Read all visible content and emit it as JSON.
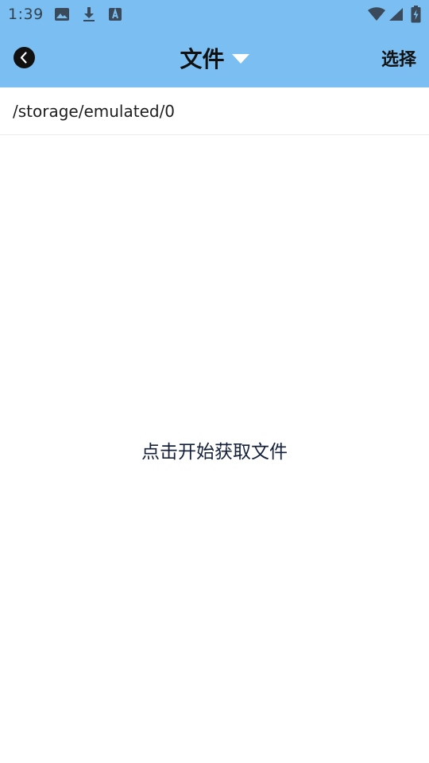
{
  "status_bar": {
    "time": "1:39",
    "icons": [
      "image-icon",
      "download-icon",
      "font-a-icon",
      "wifi-icon",
      "signal-icon",
      "battery-charging-icon"
    ]
  },
  "app_bar": {
    "back_icon": "chevron-left-icon",
    "title": "文件",
    "title_dropdown_icon": "caret-down-icon",
    "select_label": "选择"
  },
  "path_bar": {
    "path": "/storage/emulated/0"
  },
  "content": {
    "empty_message": "点击开始获取文件"
  },
  "colors": {
    "app_bar_bg": "#7bbff2",
    "background": "#ffffff",
    "text_primary": "#111111"
  }
}
